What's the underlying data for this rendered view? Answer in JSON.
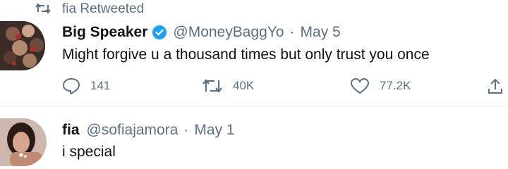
{
  "context": {
    "retweeted_by": "fia Retweeted",
    "icon": "retweet-icon"
  },
  "tweets": [
    {
      "name": "Big Speaker",
      "verified": true,
      "handle": "@MoneyBaggYo",
      "separator": "·",
      "date": "May 5",
      "text": "Might forgive u a thousand times but only trust you once",
      "stats": {
        "replies": "141",
        "retweets": "40K",
        "likes": "77.2K"
      }
    },
    {
      "name": "fia",
      "handle": "@sofiajamora",
      "separator": "·",
      "date": "May 1",
      "text": "i special"
    }
  ],
  "colors": {
    "accent": "#1da1f2",
    "muted": "#5b7083",
    "text": "#0f1419",
    "divider": "#e6ecf0"
  }
}
